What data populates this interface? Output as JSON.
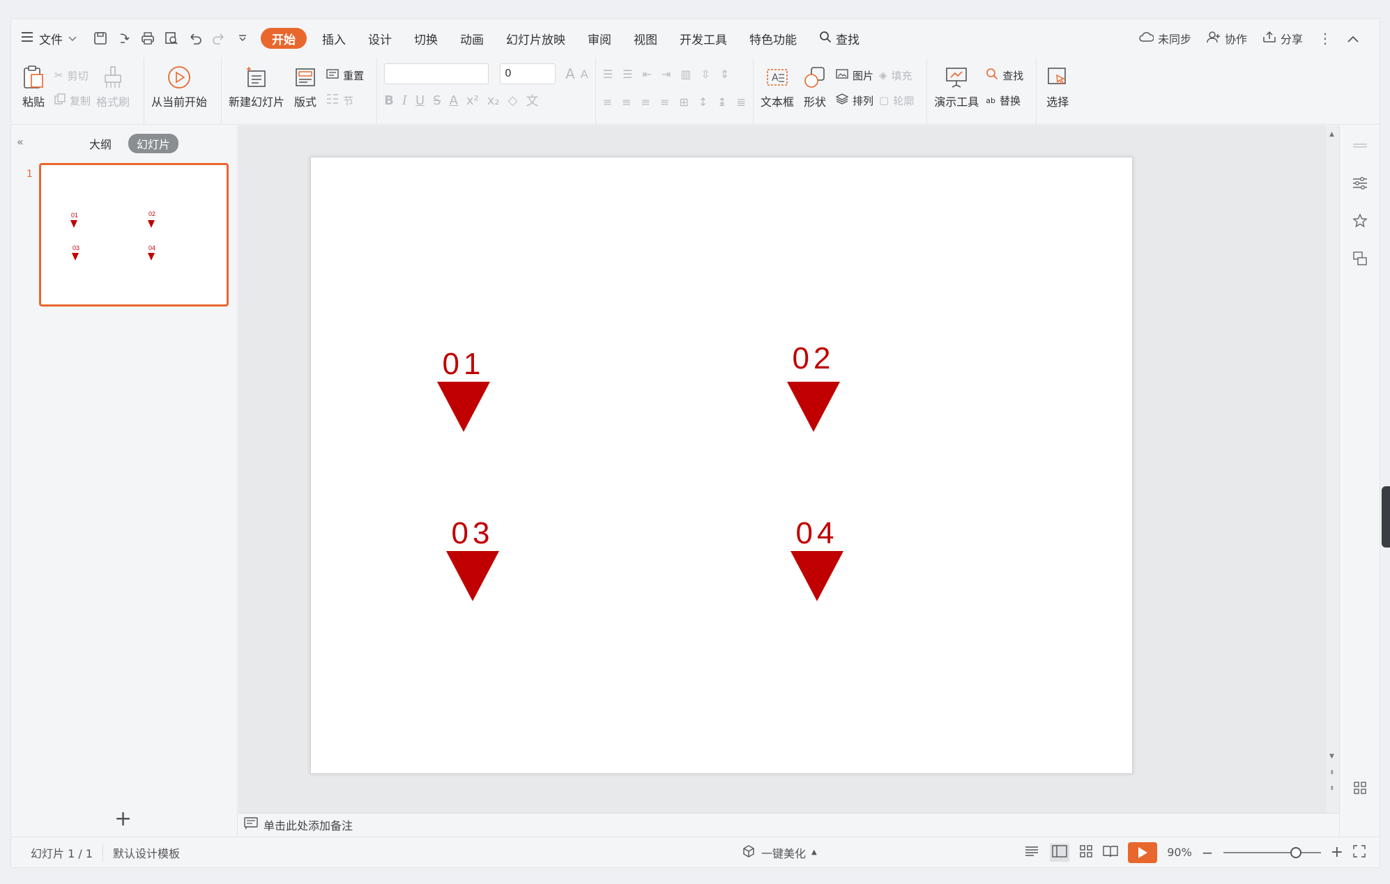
{
  "menubar": {
    "file_label": "文件",
    "tabs": [
      "开始",
      "插入",
      "设计",
      "切换",
      "动画",
      "幻灯片放映",
      "审阅",
      "视图",
      "开发工具",
      "特色功能"
    ],
    "search_label": "查找",
    "right": {
      "sync": "未同步",
      "collab": "协作",
      "share": "分享"
    }
  },
  "ribbon": {
    "paste": "粘贴",
    "cut": "剪切",
    "copy": "复制",
    "format_painter": "格式刷",
    "from_current": "从当前开始",
    "new_slide": "新建幻灯片",
    "layout": "版式",
    "reset": "重置",
    "section": "节",
    "font_size_value": "0",
    "textbox": "文本框",
    "shape": "形状",
    "picture": "图片",
    "fill": "填充",
    "arrange": "排列",
    "outline": "轮廓",
    "present_tools": "演示工具",
    "find": "查找",
    "replace": "替换",
    "select": "选择"
  },
  "leftpanel": {
    "tab_outline": "大纲",
    "tab_slides": "幻灯片",
    "slide_number": "1"
  },
  "slide": {
    "markers": [
      {
        "num": "01"
      },
      {
        "num": "02"
      },
      {
        "num": "03"
      },
      {
        "num": "04"
      }
    ],
    "accent": "#c00000"
  },
  "notes": {
    "placeholder": "单击此处添加备注"
  },
  "statusbar": {
    "slide_count": "幻灯片 1 / 1",
    "template": "默认设计模板",
    "beautify": "一键美化",
    "zoom": "90%"
  },
  "colors": {
    "accent": "#e8672c",
    "marker": "#c00000"
  }
}
